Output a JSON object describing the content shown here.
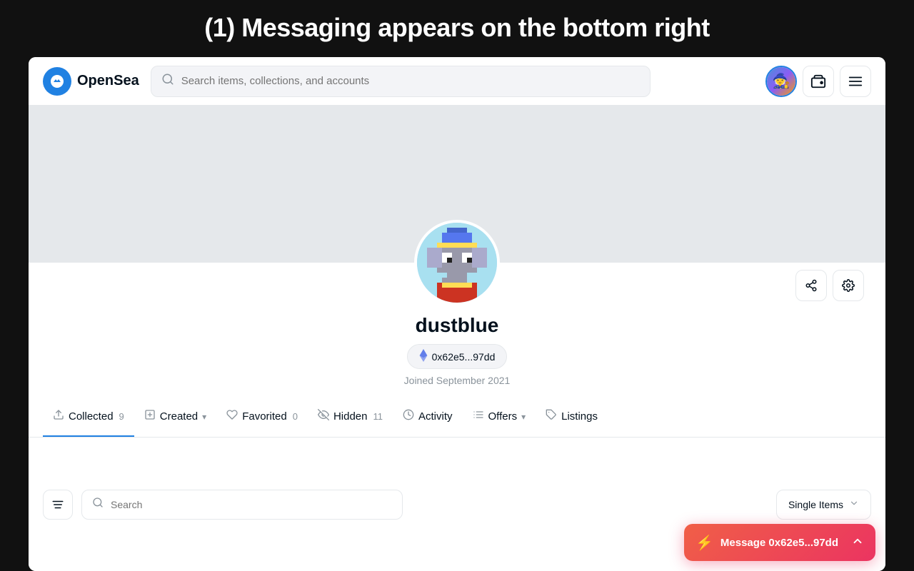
{
  "banner": {
    "title": "(1) Messaging appears on the bottom right"
  },
  "navbar": {
    "logo_text": "OpenSea",
    "search_placeholder": "Search items, collections, and accounts"
  },
  "profile": {
    "username": "dustblue",
    "wallet_address": "0x62e5...97dd",
    "joined": "Joined September 2021",
    "share_label": "Share",
    "settings_label": "Settings"
  },
  "tabs": [
    {
      "id": "collected",
      "label": "Collected",
      "count": "9",
      "active": true,
      "has_chevron": false
    },
    {
      "id": "created",
      "label": "Created",
      "count": "",
      "active": false,
      "has_chevron": true
    },
    {
      "id": "favorited",
      "label": "Favorited",
      "count": "0",
      "active": false,
      "has_chevron": false
    },
    {
      "id": "hidden",
      "label": "Hidden",
      "count": "11",
      "active": false,
      "has_chevron": false
    },
    {
      "id": "activity",
      "label": "Activity",
      "count": "",
      "active": false,
      "has_chevron": false
    },
    {
      "id": "offers",
      "label": "Offers",
      "count": "",
      "active": false,
      "has_chevron": true
    },
    {
      "id": "listings",
      "label": "Listings",
      "count": "",
      "active": false,
      "has_chevron": false
    }
  ],
  "content": {
    "search_placeholder": "Search",
    "sort_label": "Single Items",
    "filter_icon": "filter"
  },
  "toast": {
    "text": "Message 0x62e5...97dd",
    "icon": "⚡"
  }
}
